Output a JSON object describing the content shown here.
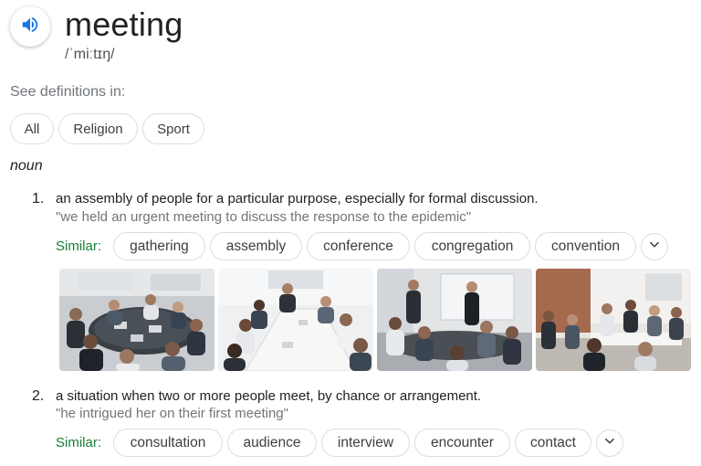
{
  "entry": {
    "word": "meeting",
    "phonetic": "/ˈmiːtɪŋ/"
  },
  "icons": {
    "speaker": "speaker-icon",
    "expand": "chevron-down-icon"
  },
  "see_definitions": {
    "label": "See definitions in:",
    "chips": [
      "All",
      "Religion",
      "Sport"
    ]
  },
  "part_of_speech": "noun",
  "senses": [
    {
      "number": "1.",
      "definition": "an assembly of people for a particular purpose, especially for formal discussion.",
      "example": "\"we held an urgent meeting to discuss the response to the epidemic\"",
      "similar_label": "Similar:",
      "synonyms": [
        "gathering",
        "assembly",
        "conference",
        "congregation",
        "convention"
      ]
    },
    {
      "number": "2.",
      "definition": "a situation when two or more people meet, by chance or arrangement.",
      "example": "\"he intrigued her on their first meeting\"",
      "similar_label": "Similar:",
      "synonyms": [
        "consultation",
        "audience",
        "interview",
        "encounter",
        "contact"
      ]
    }
  ],
  "images": [
    {
      "subject": "meeting-photo-1"
    },
    {
      "subject": "meeting-photo-2"
    },
    {
      "subject": "meeting-photo-3"
    },
    {
      "subject": "meeting-photo-4"
    }
  ],
  "colors": {
    "similar": "#188038",
    "speaker": "#1a73e8",
    "muted": "#70757a"
  }
}
